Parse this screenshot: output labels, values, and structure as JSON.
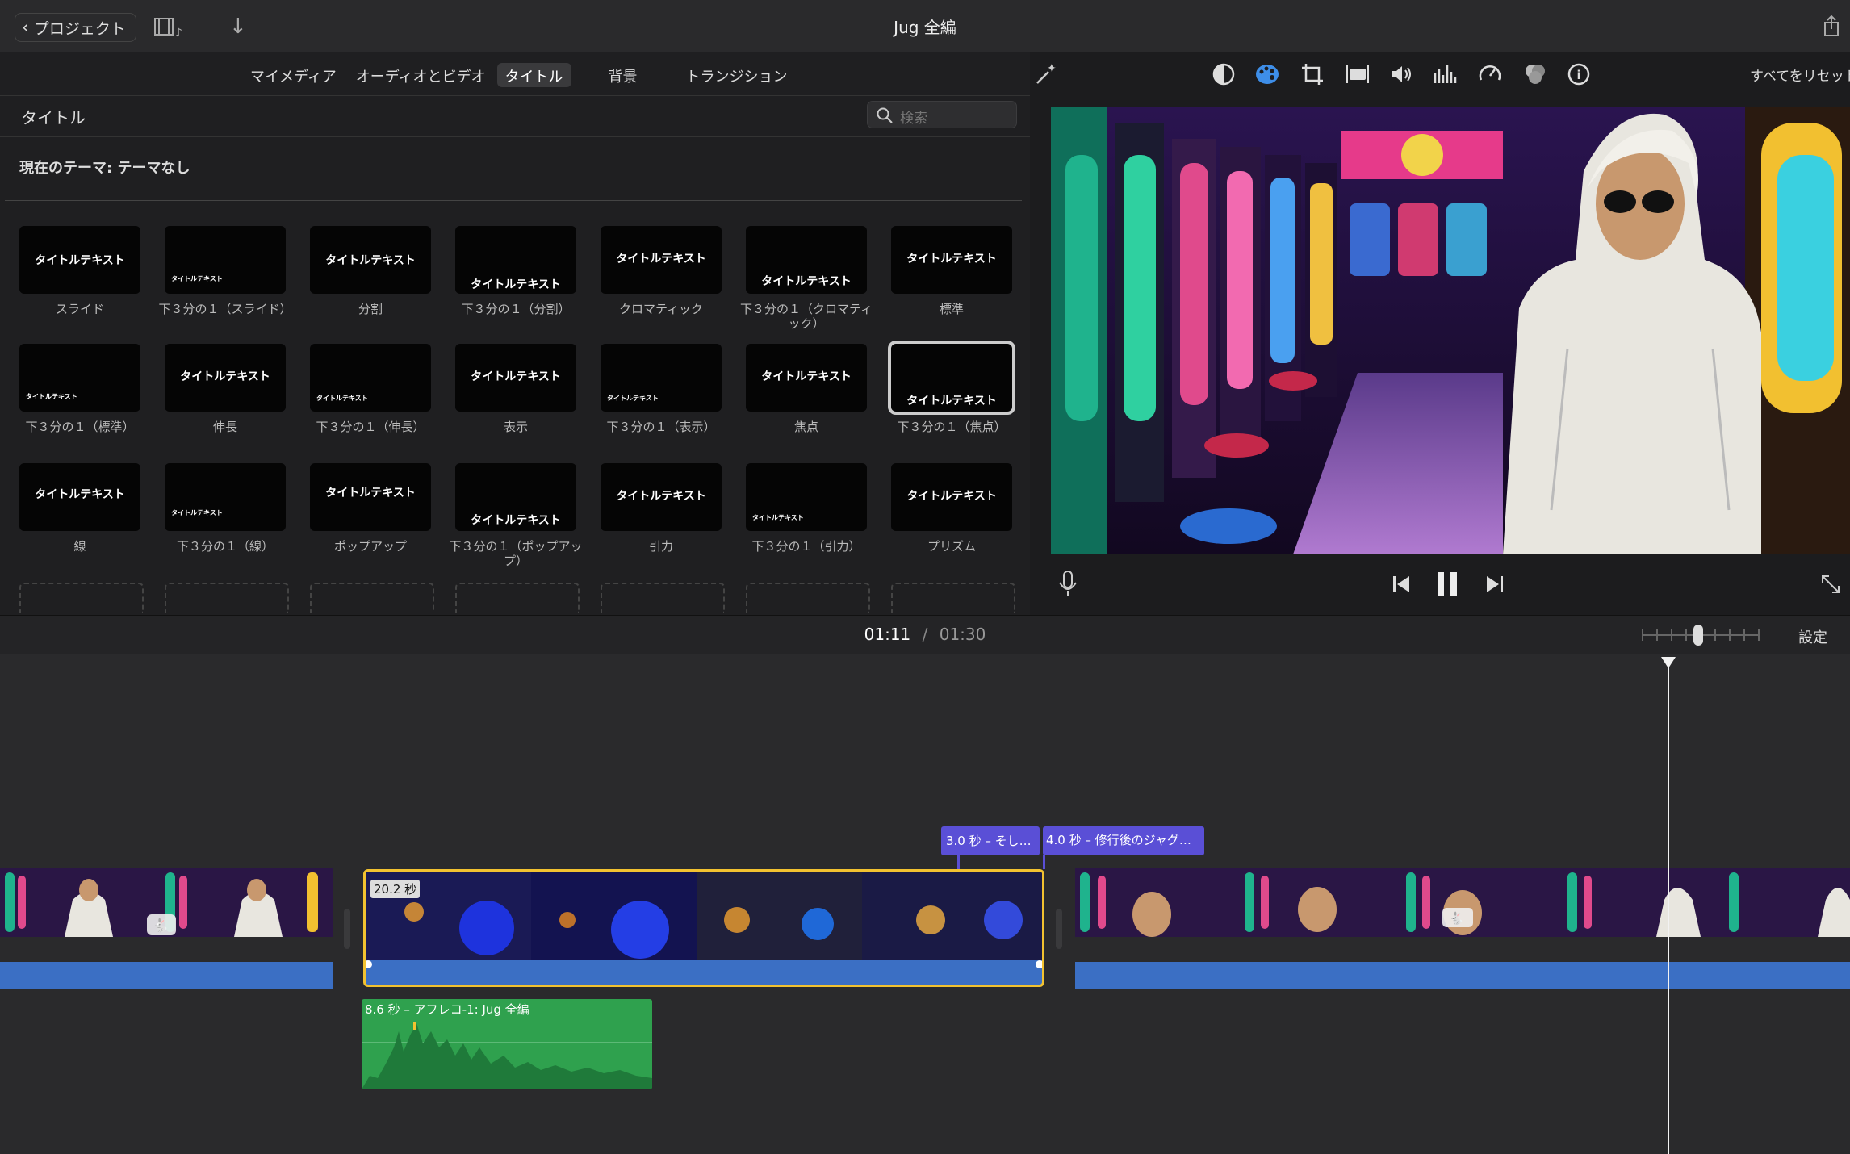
{
  "topbar": {
    "back_label": "プロジェクト",
    "project_title": "Jug 全編"
  },
  "library": {
    "tabs": [
      {
        "label": "マイメディア",
        "active": false
      },
      {
        "label": "オーディオとビデオ",
        "active": false
      },
      {
        "label": "タイトル",
        "active": true
      },
      {
        "label": "背景",
        "active": false
      },
      {
        "label": "トランジション",
        "active": false
      }
    ],
    "section_label": "タイトル",
    "search_placeholder": "検索",
    "current_theme": "現在のテーマ: テーマなし",
    "tile_text": "タイトルテキスト",
    "titles": [
      "スライド",
      "下３分の１（スライド）",
      "分割",
      "下３分の１（分割）",
      "クロマティック",
      "下３分の１（クロマティック）",
      "標準",
      "下３分の１（標準）",
      "伸長",
      "下３分の１（伸長）",
      "表示",
      "下３分の１（表示）",
      "焦点",
      "下３分の１（焦点）",
      "線",
      "下３分の１（線）",
      "ポップアップ",
      "下３分の１（ポップアップ）",
      "引力",
      "下３分の１（引力）",
      "プリズム"
    ],
    "selected_title": "下３分の１（焦点）"
  },
  "viewer": {
    "reset_label": "すべてをリセット",
    "tool_icons": [
      "magic-wand-icon",
      "color-balance-icon",
      "color-correction-icon",
      "crop-icon",
      "stabilization-icon",
      "volume-icon",
      "equalizer-icon",
      "speed-icon",
      "noise-reduction-icon",
      "info-icon"
    ],
    "active_tool": "color-correction-icon"
  },
  "timeline": {
    "current_time": "01:11",
    "separator": "/",
    "total_time": "01:30",
    "settings_label": "設定",
    "clip_duration": "20.2 秒",
    "title_clip_1": "3.0 秒 – そし…",
    "title_clip_2": "4.0 秒 – 修行後のジャグ…",
    "audio_clip": "8.6 秒 – アフレコ-1: Jug 全編",
    "colors": {
      "selection": "#f2c230",
      "title_clip": "#5a4fd6",
      "audio_clip": "#2fa14e",
      "audio_wave": "#3b6fc4"
    }
  }
}
